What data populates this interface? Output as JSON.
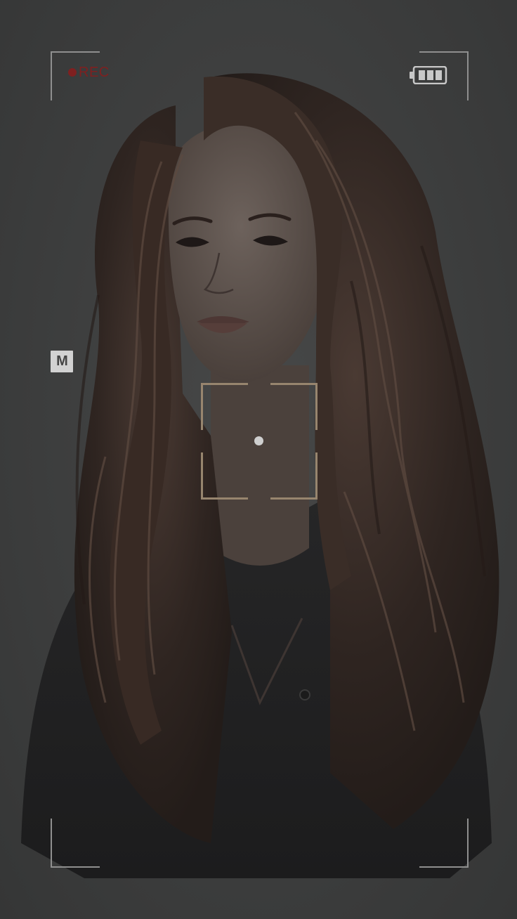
{
  "viewfinder": {
    "recording_label": "REC",
    "recording_color": "#7f2020",
    "mode_label": "M",
    "battery_level": 1.0,
    "battery_icon": "battery-full-icon",
    "frame_color": "#8f8f8f",
    "focus_color": "#97856e"
  },
  "photo": {
    "subject": "portrait-sketch"
  }
}
